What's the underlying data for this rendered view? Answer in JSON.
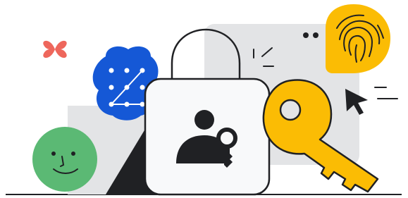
{
  "illustration": {
    "kind": "security-access-illustration",
    "colors": {
      "background": "#ffffff",
      "outline": "#202124",
      "panel_gray": "#e3e4e6",
      "lock_body": "#f8f9fa",
      "pattern_blue": "#1558d6",
      "fingerprint_yellow": "#fbbc04",
      "key_yellow": "#fbbc04",
      "face_green": "#5bb974",
      "sparkle_red": "#ee675c",
      "dark_wedge": "#202124"
    },
    "icons": [
      "sparkle-icon",
      "pattern-unlock-icon",
      "smiley-face-icon",
      "padlock-icon",
      "user-key-icon",
      "fingerprint-icon",
      "key-icon",
      "mouse-cursor-icon"
    ]
  }
}
